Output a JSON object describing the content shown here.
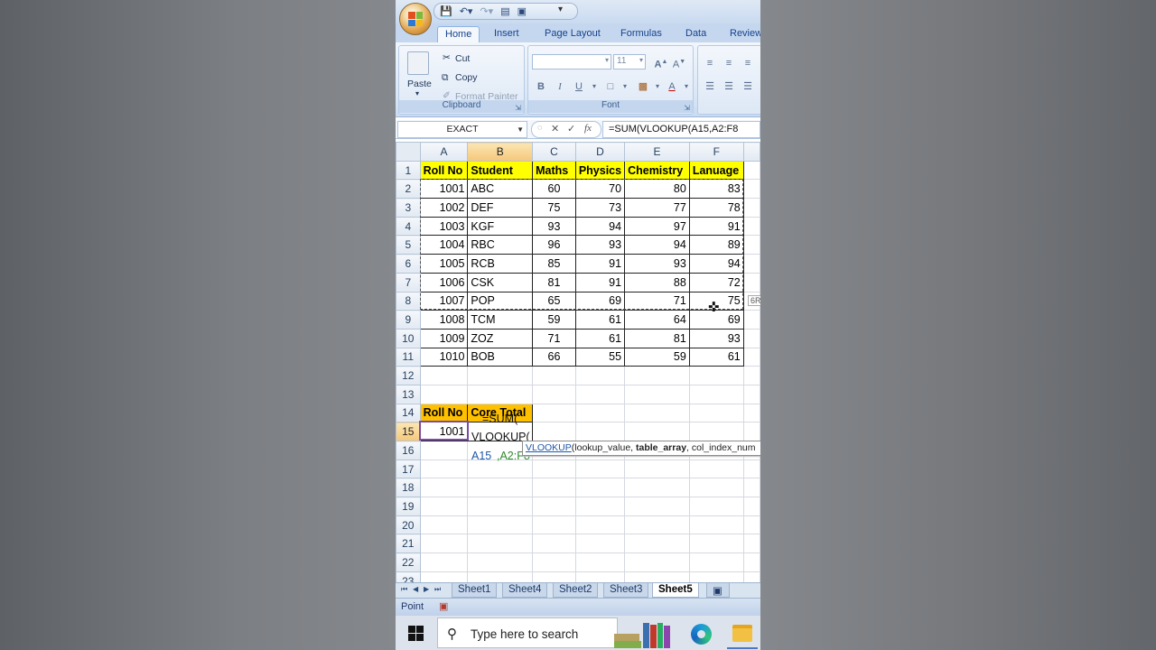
{
  "tabs": [
    "Home",
    "Insert",
    "Page Layout",
    "Formulas",
    "Data",
    "Review"
  ],
  "clipboard": {
    "paste": "Paste",
    "cut": "Cut",
    "copy": "Copy",
    "format_painter": "Format Painter",
    "label": "Clipboard"
  },
  "font": {
    "size": "11",
    "bold": "B",
    "italic": "I",
    "underline": "U",
    "label": "Font"
  },
  "name_box": "EXACT",
  "formula": "=SUM(VLOOKUP(A15,A2:F8",
  "columns": [
    "A",
    "B",
    "C",
    "D",
    "E",
    "F"
  ],
  "rows": [
    [
      "Roll No",
      "Student",
      "Maths",
      "Physics",
      "Chemistry",
      "Lanuage"
    ],
    [
      "1001",
      "ABC",
      "60",
      "70",
      "80",
      "83"
    ],
    [
      "1002",
      "DEF",
      "75",
      "73",
      "77",
      "78"
    ],
    [
      "1003",
      "KGF",
      "93",
      "94",
      "97",
      "91"
    ],
    [
      "1004",
      "RBC",
      "96",
      "93",
      "94",
      "89"
    ],
    [
      "1005",
      "RCB",
      "85",
      "91",
      "93",
      "94"
    ],
    [
      "1006",
      "CSK",
      "81",
      "91",
      "88",
      "72"
    ],
    [
      "1007",
      "POP",
      "65",
      "69",
      "71",
      "75"
    ],
    [
      "1008",
      "TCM",
      "59",
      "61",
      "64",
      "69"
    ],
    [
      "1009",
      "ZOZ",
      "71",
      "61",
      "81",
      "93"
    ],
    [
      "1010",
      "BOB",
      "66",
      "55",
      "59",
      "61"
    ]
  ],
  "lookup_table": {
    "headers": [
      "Roll No",
      "Core Total"
    ],
    "roll": "1001",
    "edit_sum": "=SUM(",
    "edit_vlookup": "VLOOKUP(",
    "edit_ref_a": "A15",
    "edit_ref_b": ",A2:F8"
  },
  "tooltip": {
    "fn": "VLOOKUP",
    "args_open": "(lookup_value, ",
    "table_array": "table_array",
    "rest": ", col_index_num"
  },
  "size_tip": "6R",
  "sheets": [
    "Sheet1",
    "Sheet4",
    "Sheet2",
    "Sheet3",
    "Sheet5"
  ],
  "active_sheet": "Sheet5",
  "status": "Point",
  "taskbar": {
    "search_placeholder": "Type here to search"
  },
  "colors": {
    "header_yellow": "#ffff00",
    "header_orange": "#ffc000",
    "ribbon_blue": "#c5d7ef"
  }
}
